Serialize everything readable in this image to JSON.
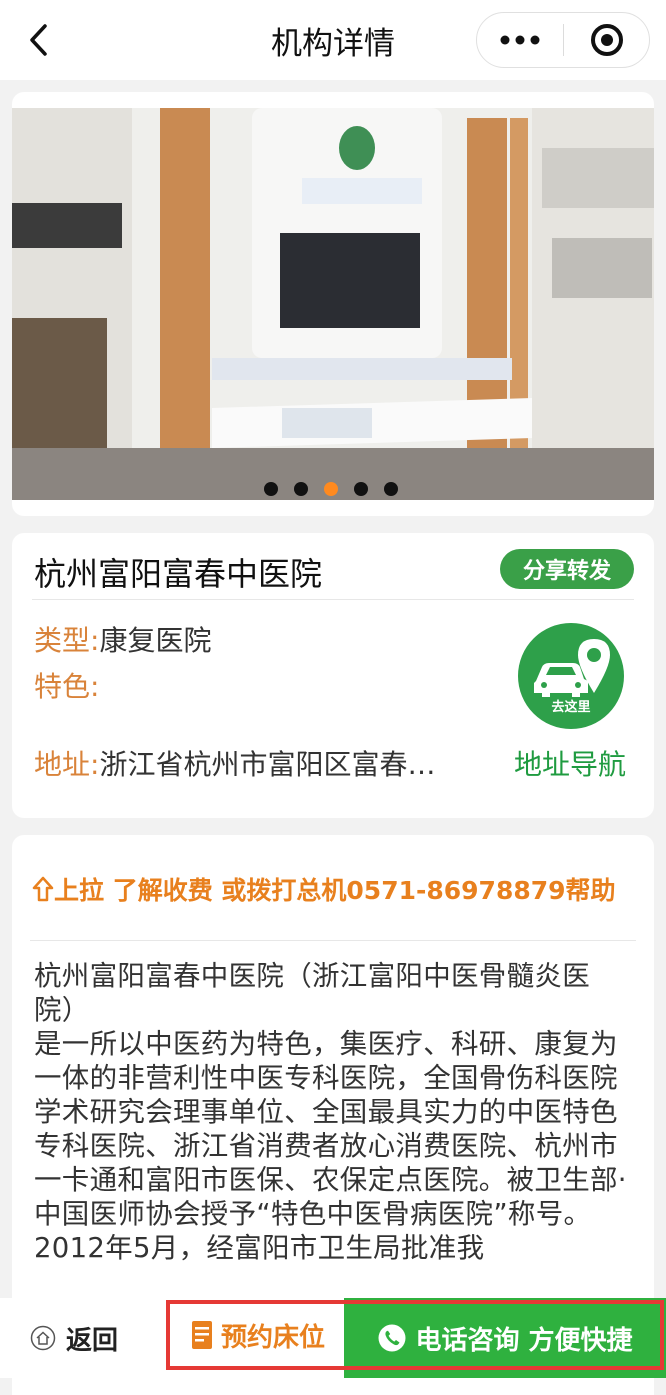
{
  "header": {
    "title": "机构详情"
  },
  "banner": {
    "slide_count": 5,
    "active_index": 2
  },
  "hospital": {
    "name": "杭州富阳富春中医院",
    "share_label": "分享转发",
    "type_label": "类型:",
    "type_value": "康复医院",
    "feature_label": "特色:",
    "feature_value": "",
    "address_label": "地址:",
    "address_value": "浙江省杭州市富阳区富春…",
    "go_label": "去这里",
    "nav_label": "地址导航"
  },
  "description": {
    "notice": "上拉 了解收费 或拨打总机0571-86978879帮助",
    "text": "杭州富阳富春中医院（浙江富阳中医骨髓炎医院）\n是一所以中医药为特色，集医疗、科研、康复为一体的非营利性中医专科医院，全国骨伤科医院学术研究会理事单位、全国最具实力的中医特色专科医院、浙江省消费者放心消费医院、杭州市一卡通和富阳市医保、农保定点医院。被卫生部·中国医师协会授予“特色中医骨病医院”称号。2012年5月，经富阳市卫生局批准我"
  },
  "bottom_bar": {
    "back_label": "返回",
    "book_label": "预约床位",
    "call_label": "电话咨询 方便快捷"
  },
  "colors": {
    "accent_orange": "#e8801e",
    "accent_green": "#2fb13f",
    "highlight_red": "#e53935"
  }
}
